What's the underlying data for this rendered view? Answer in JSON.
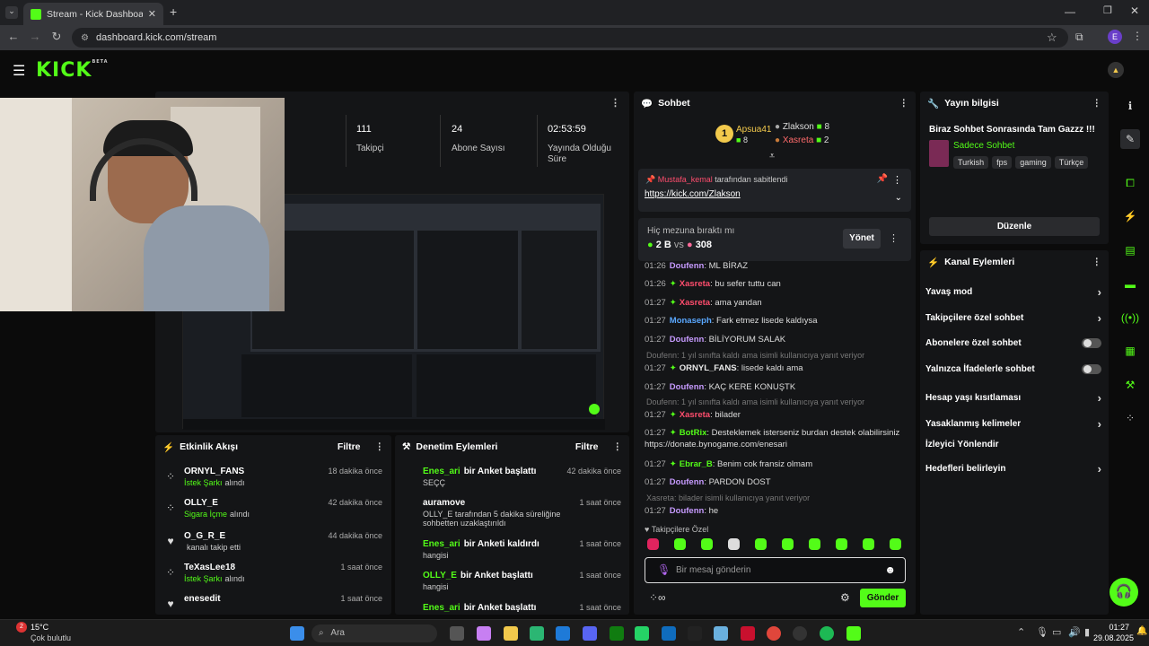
{
  "browser": {
    "tab_title": "Stream - Kick Dashboard",
    "url": "dashboard.kick.com/stream",
    "profile_initial": "E"
  },
  "kick": {
    "logo": "KICK",
    "beta": "BETA"
  },
  "stats": [
    {
      "value": "111",
      "label": "Takipçi"
    },
    {
      "value": "24",
      "label": "Abone Sayısı"
    },
    {
      "value": "02:53:59",
      "label": "Yayında Olduğu Süre"
    }
  ],
  "chat": {
    "title": "Sohbet",
    "leaderboard": {
      "first_name": "Apsua41",
      "first_count": "8",
      "rank1": "1",
      "second_name": "Zlakson",
      "second_count": "8",
      "third_name": "Xasreta",
      "third_count": "2"
    },
    "pinned": {
      "pinned_by": "Mustafa_kemal",
      "pinned_suffix": "tarafından sabitlendi",
      "link": "https://kick.com/Zlakson"
    },
    "prediction": {
      "question": "Hiç mezuna bıraktı mı",
      "left": "2 B",
      "vs": "vs",
      "right": "308",
      "manage": "Yönet"
    },
    "messages": [
      {
        "ts": "01:26",
        "user": "Doufenn",
        "color": "#c79bff",
        "text": "ML BİRAZ"
      },
      {
        "ts": "01:26",
        "user": "Xasreta",
        "color": "#ff4d6d",
        "text": "bu sefer tuttu can"
      },
      {
        "ts": "01:27",
        "user": "Xasreta",
        "color": "#ff4d6d",
        "text": "ama yandan"
      },
      {
        "ts": "01:27",
        "user": "Monaseph",
        "color": "#5aa8ff",
        "text": "Fark etmez lisede kaldıysa"
      },
      {
        "ts": "01:27",
        "user": "Doufenn",
        "color": "#c79bff",
        "text": "BİLİYORUM SALAK"
      },
      {
        "ts": "01:27",
        "user": "ORNYL_FANS",
        "color": "#e9e9e9",
        "text": "lisede kaldı ama"
      },
      {
        "ts": "01:27",
        "user": "Doufenn",
        "color": "#c79bff",
        "text": "KAÇ KERE KONUŞTK"
      },
      {
        "ts": "01:27",
        "user": "Xasreta",
        "color": "#ff4d6d",
        "text": "bilader"
      },
      {
        "ts": "01:27",
        "user": "BotRix",
        "color": "#53fc18",
        "text": "Desteklemek isterseniz burdan destek olabilirsiniz https://donate.bynogame.com/enesari"
      },
      {
        "ts": "01:27",
        "user": "Ebrar_B",
        "color": "#53fc18",
        "text": "Benim cok fransiz olmam"
      },
      {
        "ts": "01:27",
        "user": "Doufenn",
        "color": "#c79bff",
        "text": "PARDON DOST"
      },
      {
        "ts": "01:27",
        "user": "Doufenn",
        "color": "#c79bff",
        "text": "he"
      }
    ],
    "replies": [
      "Doufenn: 1 yıl sınıfta kaldı ama isimli kullanıcıya yanıt veriyor",
      "Doufenn: 1 yıl sınıfta kaldı ama isimli kullanıcıya yanıt veriyor",
      "Xasreta: bilader isimli kullanıcıya yanıt veriyor"
    ],
    "followers_only": "Takipçilere Özel",
    "input_placeholder": "Bir mesaj gönderin",
    "send": "Gönder"
  },
  "activity": {
    "title": "Etkinlik Akışı",
    "filter": "Filtre",
    "rows": [
      {
        "name": "ORNYL_FANS",
        "sub_hl": "İstek Şarkı",
        "sub": "alındı",
        "time": "18 dakika önce"
      },
      {
        "name": "OLLY_E",
        "sub_hl": "Sigara İçme",
        "sub": "alındı",
        "time": "42 dakika önce"
      },
      {
        "name": "O_G_R_E",
        "sub_hl": "",
        "sub": "kanalı takip etti",
        "time": "44 dakika önce"
      },
      {
        "name": "TeXasLee18",
        "sub_hl": "İstek Şarkı",
        "sub": "alındı",
        "time": "1 saat önce"
      },
      {
        "name": "enesedit",
        "sub_hl": "",
        "sub": "",
        "time": "1 saat önce"
      }
    ]
  },
  "moderation": {
    "title": "Denetim Eylemleri",
    "filter": "Filtre",
    "rows": [
      {
        "name": "Enes_ari",
        "action": "bir Anket başlattı",
        "sub": "SEÇÇ",
        "time": "42 dakika önce"
      },
      {
        "name": "auramove",
        "action": "",
        "sub": "OLLY_E tarafından 5 dakika süreliğine sohbetten uzaklaştırıldı",
        "time": "1 saat önce"
      },
      {
        "name": "Enes_ari",
        "action": "bir Anketi kaldırdı",
        "sub": "hangisi",
        "time": "1 saat önce"
      },
      {
        "name": "OLLY_E",
        "action": "bir Anket başlattı",
        "sub": "hangisi",
        "time": "1 saat önce"
      },
      {
        "name": "Enes_ari",
        "action": "bir Anket başlattı",
        "sub": "",
        "time": "1 saat önce"
      }
    ]
  },
  "stream_info": {
    "title": "Yayın bilgisi",
    "stream_title": "Biraz Sohbet Sonrasında Tam Gazzz !!!",
    "category": "Sadece Sohbet",
    "tags": [
      "Turkish",
      "fps",
      "gaming",
      "Türkçe"
    ],
    "edit": "Düzenle"
  },
  "channel_actions": {
    "title": "Kanal Eylemleri",
    "items": [
      {
        "label": "Yavaş mod",
        "kind": "chevron"
      },
      {
        "label": "Takipçilere özel sohbet",
        "kind": "chevron"
      },
      {
        "label": "Abonelere özel sohbet",
        "kind": "toggle"
      },
      {
        "label": "Yalnızca İfadelerle sohbet",
        "kind": "toggle"
      },
      {
        "label": "Hesap yaşı kısıtlaması",
        "kind": "chevron"
      },
      {
        "label": "Yasaklanmış kelimeler",
        "kind": "chevron"
      },
      {
        "label": "İzleyici Yönlendir",
        "kind": "none"
      },
      {
        "label": "Hedefleri belirleyin",
        "kind": "chevron"
      }
    ]
  },
  "taskbar": {
    "weather_temp": "15°C",
    "weather_text": "Çok bulutlu",
    "search": "Ara",
    "time": "01:27",
    "date": "29.08.2025"
  },
  "colors": {
    "accent": "#53fc18",
    "panel": "#141517",
    "bg": "#0b0b0b"
  }
}
